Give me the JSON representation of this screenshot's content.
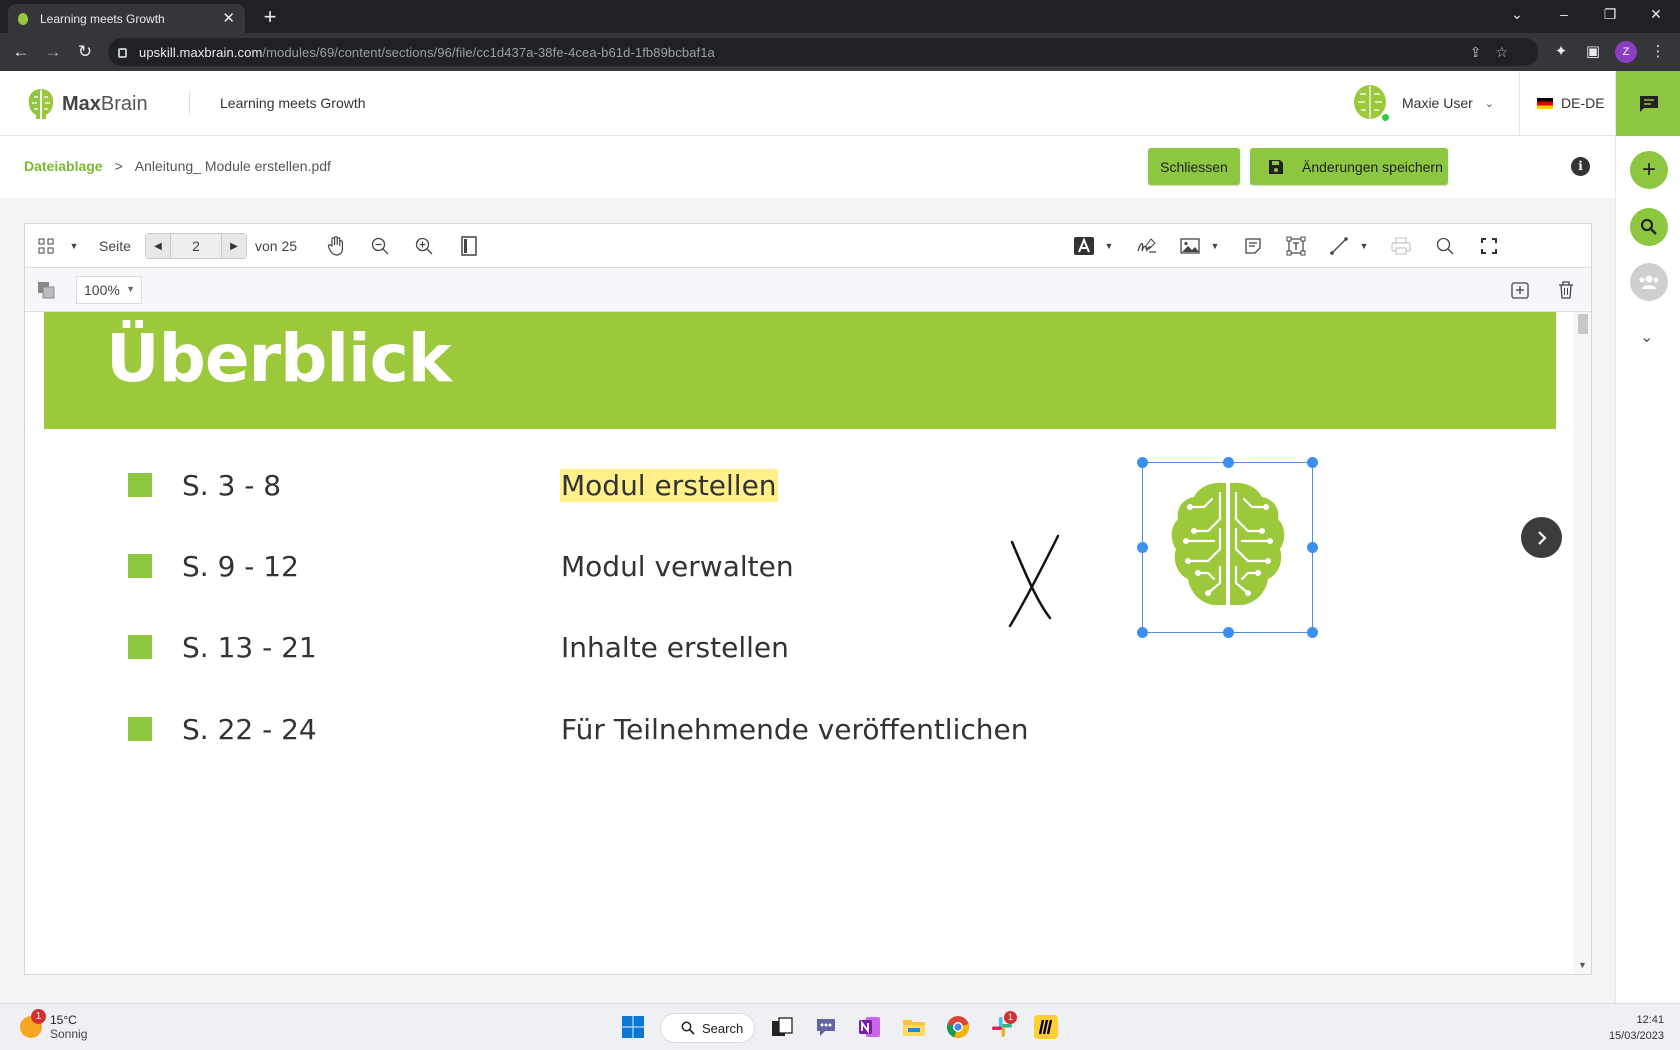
{
  "browser": {
    "tab_title": "Learning meets Growth",
    "tab_close": "✕",
    "new_tab": "+",
    "url_host": "upskill.maxbrain.com",
    "url_path": "/modules/69/content/sections/96/file/cc1d437a-38fe-4cea-b61d-1fb89bcbaf1a",
    "profile_initial": "Z"
  },
  "header": {
    "logo_bold": "Max",
    "logo_light": "Brain",
    "tagline": "Learning meets Growth",
    "user_name": "Maxie User",
    "language": "DE-DE"
  },
  "breadcrumb": {
    "root": "Dateiablage",
    "separator": ">",
    "file": "Anleitung_ Module erstellen.pdf"
  },
  "actions": {
    "close_label": "Schliessen",
    "save_label": "Änderungen speichern",
    "info_label": "i"
  },
  "viewer": {
    "page_label": "Seite",
    "current_page": "2",
    "of_label": "von 25",
    "zoom": "100%"
  },
  "slide": {
    "title": "Überblick",
    "rows": [
      {
        "pages": "S. 3 - 8",
        "topic": "Modul erstellen",
        "highlighted": true
      },
      {
        "pages": "S. 9 - 12",
        "topic": "Modul verwalten",
        "highlighted": false
      },
      {
        "pages": "S. 13 - 21",
        "topic": "Inhalte erstellen",
        "highlighted": false
      },
      {
        "pages": "S. 22 - 24",
        "topic": "Für Teilnehmende veröffentlichen",
        "highlighted": false
      }
    ]
  },
  "taskbar": {
    "temperature": "15°C",
    "condition": "Sonnig",
    "weather_badge": "1",
    "search_label": "Search",
    "slack_badge": "1",
    "time": "12:41",
    "date": "15/03/2023"
  },
  "colors": {
    "brand_green": "#8dc63f",
    "banner_green": "#9cc93c",
    "highlight": "#fff08a",
    "selection_blue": "#3b8ff3"
  }
}
